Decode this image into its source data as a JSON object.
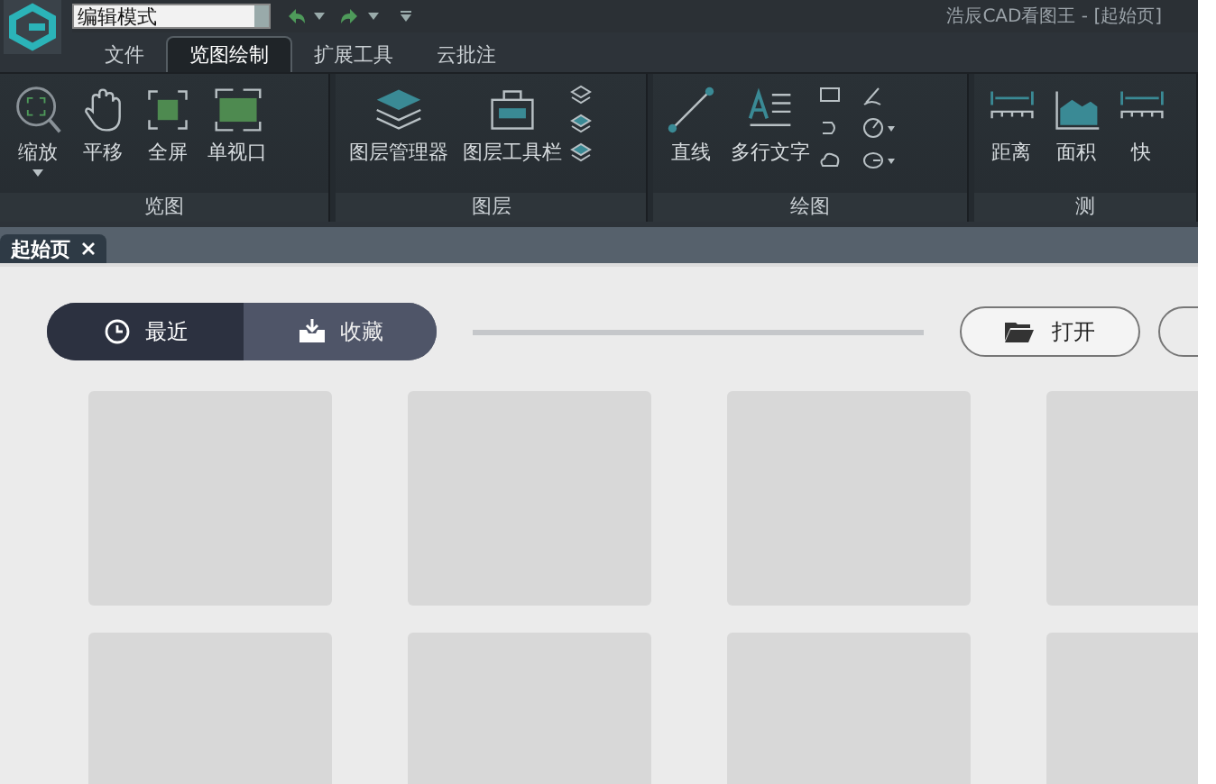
{
  "mode_select": {
    "value": "编辑模式"
  },
  "window": {
    "title": "浩辰CAD看图王 - [起始页]"
  },
  "menu_tabs": [
    {
      "label": "文件",
      "selected": false
    },
    {
      "label": "览图绘制",
      "selected": true
    },
    {
      "label": "扩展工具",
      "selected": false
    },
    {
      "label": "云批注",
      "selected": false
    }
  ],
  "ribbon_groups": [
    {
      "label": "览图",
      "tools": [
        {
          "kind": "zoom",
          "label": "缩放",
          "dropdown": true
        },
        {
          "kind": "pan",
          "label": "平移",
          "dropdown": false
        },
        {
          "kind": "fullscreen",
          "label": "全屏",
          "dropdown": false
        },
        {
          "kind": "viewport",
          "label": "单视口",
          "dropdown": false
        }
      ]
    },
    {
      "label": "图层",
      "tools": [
        {
          "kind": "layers",
          "label": "图层管理器",
          "dropdown": false
        },
        {
          "kind": "toolbar",
          "label": "图层工具栏",
          "dropdown": false
        },
        {
          "kind": "layerstack"
        }
      ]
    },
    {
      "label": "绘图",
      "tools": [
        {
          "kind": "line",
          "label": "直线",
          "dropdown": false
        },
        {
          "kind": "mtext",
          "label": "多行文字",
          "dropdown": false
        },
        {
          "kind": "shapes"
        }
      ]
    },
    {
      "label": "测",
      "tools": [
        {
          "kind": "distance",
          "label": "距离",
          "dropdown": false
        },
        {
          "kind": "area",
          "label": "面积",
          "dropdown": false
        },
        {
          "kind": "quick",
          "label": "快",
          "dropdown": false
        }
      ]
    }
  ],
  "doc_tabs": [
    {
      "label": "起始页",
      "selected": true
    }
  ],
  "segments": [
    {
      "kind": "recent",
      "label": "最近",
      "selected": true
    },
    {
      "kind": "favorites",
      "label": "收藏",
      "selected": false
    }
  ],
  "open_button": {
    "label": "打开"
  },
  "thumbnails": [
    {
      "kind": "placeholder"
    },
    {
      "kind": "placeholder"
    },
    {
      "kind": "placeholder"
    },
    {
      "kind": "placeholder"
    },
    {
      "kind": "placeholder"
    },
    {
      "kind": "placeholder"
    },
    {
      "kind": "placeholder"
    },
    {
      "kind": "placeholder"
    }
  ]
}
